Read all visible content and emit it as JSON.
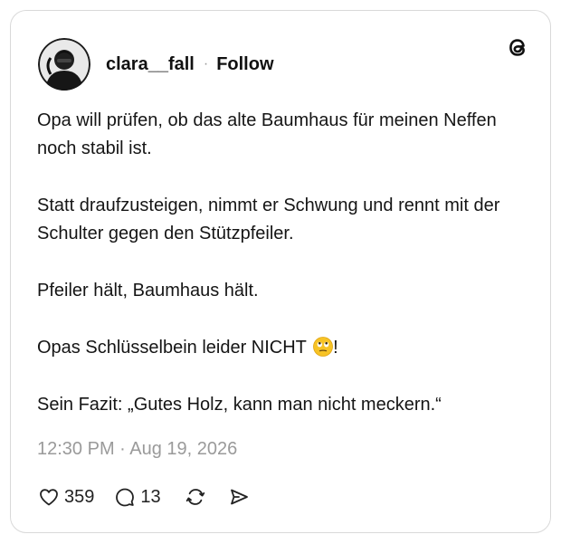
{
  "post": {
    "author": {
      "username": "clara__fall",
      "follow_label": "Follow",
      "avatar_icon": "avatar-figure"
    },
    "separator": "·",
    "paragraphs": [
      "Opa will prüfen, ob das alte Baumhaus für meinen Neffen noch stabil ist.",
      "Statt draufzusteigen, nimmt er Schwung und rennt mit der Schulter gegen den Stützpfeiler.",
      "Pfeiler hält, Baumhaus hält.",
      "Opas Schlüsselbein leider NICHT",
      "Sein Fazit: „Gutes Holz, kann man nicht meckern.“"
    ],
    "paragraph4_suffix": "!",
    "emoji": "face-with-rolling-eyes",
    "timestamp": "12:30 PM · Aug 19, 2026",
    "stats": {
      "likes": "359",
      "replies": "13"
    }
  },
  "icons": {
    "brand": "threads-logo-icon",
    "like": "heart-icon",
    "reply": "speech-bubble-icon",
    "repost": "repost-icon",
    "share": "send-icon"
  },
  "colors": {
    "text": "#151515",
    "muted": "#9a9a9a",
    "border": "#d9d9d9",
    "emoji": "#f7c325"
  }
}
